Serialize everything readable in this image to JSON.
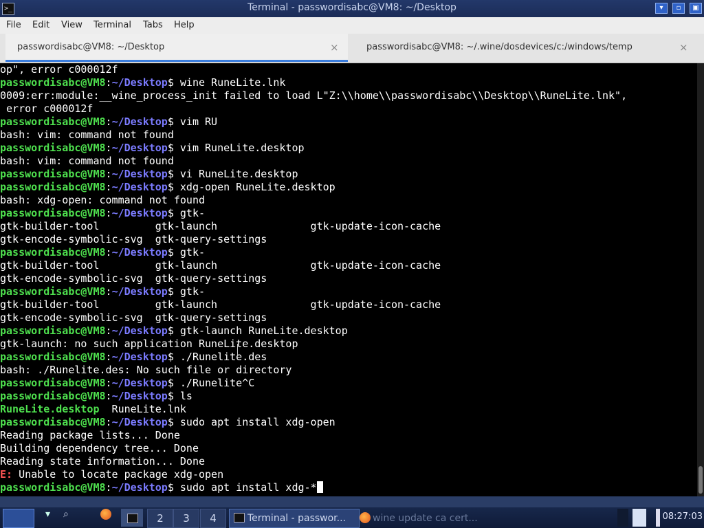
{
  "window": {
    "title": "Terminal - passwordisabc@VM8: ~/Desktop"
  },
  "menu": [
    "File",
    "Edit",
    "View",
    "Terminal",
    "Tabs",
    "Help"
  ],
  "tabs": [
    {
      "label": "passwordisabc@VM8: ~/Desktop",
      "close": "×"
    },
    {
      "label": "passwordisabc@VM8: ~/.wine/dosdevices/c:/windows/temp",
      "close": "×"
    }
  ],
  "prompt": {
    "user": "passwordisabc@VM8",
    "path": "~/Desktop"
  },
  "terminal_lines": [
    {
      "t": "o",
      "text": "op\", error c000012f"
    },
    {
      "t": "p",
      "cmd": "wine RuneLite.lnk"
    },
    {
      "t": "o",
      "text": "0009:err:module:__wine_process_init failed to load L\"Z:\\\\home\\\\passwordisabc\\\\Desktop\\\\RuneLite.lnk\","
    },
    {
      "t": "o",
      "text": " error c000012f"
    },
    {
      "t": "p",
      "cmd": "vim RU"
    },
    {
      "t": "o",
      "text": "bash: vim: command not found"
    },
    {
      "t": "p",
      "cmd": "vim RuneLite.desktop"
    },
    {
      "t": "o",
      "text": "bash: vim: command not found"
    },
    {
      "t": "p",
      "cmd": "vi RuneLite.desktop"
    },
    {
      "t": "p",
      "cmd": "xdg-open RuneLite.desktop"
    },
    {
      "t": "o",
      "text": "bash: xdg-open: command not found"
    },
    {
      "t": "p",
      "cmd": "gtk-"
    },
    {
      "t": "o",
      "text": "gtk-builder-tool         gtk-launch               gtk-update-icon-cache"
    },
    {
      "t": "o",
      "text": "gtk-encode-symbolic-svg  gtk-query-settings"
    },
    {
      "t": "p",
      "cmd": "gtk-"
    },
    {
      "t": "o",
      "text": "gtk-builder-tool         gtk-launch               gtk-update-icon-cache"
    },
    {
      "t": "o",
      "text": "gtk-encode-symbolic-svg  gtk-query-settings"
    },
    {
      "t": "p",
      "cmd": "gtk-"
    },
    {
      "t": "o",
      "text": "gtk-builder-tool         gtk-launch               gtk-update-icon-cache"
    },
    {
      "t": "o",
      "text": "gtk-encode-symbolic-svg  gtk-query-settings"
    },
    {
      "t": "p",
      "cmd": "gtk-launch RuneLite.desktop"
    },
    {
      "t": "o",
      "text": "gtk-launch: no such application RuneLite.desktop"
    },
    {
      "t": "p",
      "cmd": "./Runelite.des"
    },
    {
      "t": "o",
      "text": "bash: ./Runelite.des: No such file or directory"
    },
    {
      "t": "p",
      "cmd": "./Runelite^C"
    },
    {
      "t": "p",
      "cmd": "ls"
    },
    {
      "t": "ls",
      "green": "RuneLite.desktop",
      "rest": "  RuneLite.lnk"
    },
    {
      "t": "p",
      "cmd": "sudo apt install xdg-open"
    },
    {
      "t": "o",
      "text": "Reading package lists... Done"
    },
    {
      "t": "o",
      "text": "Building dependency tree... Done"
    },
    {
      "t": "o",
      "text": "Reading state information... Done"
    },
    {
      "t": "err",
      "label": "E:",
      "text": " Unable to locate package xdg-open"
    },
    {
      "t": "cur",
      "cmd": "sudo apt install xdg-*"
    }
  ],
  "taskbar": {
    "workspaces": [
      "2",
      "3",
      "4"
    ],
    "tasks": [
      {
        "label": "Terminal - passwor...",
        "active": true
      },
      {
        "label": "wine update ca cert...",
        "active": false
      }
    ],
    "clock": "08:27:03"
  }
}
